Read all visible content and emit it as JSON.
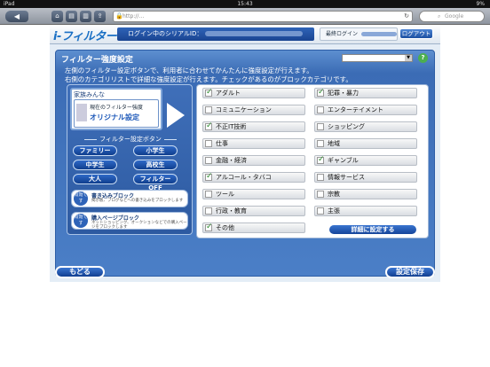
{
  "statusbar": {
    "device": "iPad",
    "time": "15:43",
    "battery": "9%"
  },
  "browser": {
    "back": "◀",
    "url_placeholder": "http://…",
    "search_placeholder": "Google"
  },
  "header": {
    "logo": "i-フィルター",
    "serial_label": "ログイン中のシリアルID：",
    "last_login_label": "最終ログイン",
    "logout": "ログアウト"
  },
  "panel": {
    "title": "フィルター強度設定",
    "desc_line1": "左側のフィルター設定ボタンで、利用者に合わせてかんたんに強度設定が行えます。",
    "desc_line2": "右側のカテゴリリストで詳細な強度設定が行えます。チェックがあるのがブロックカテゴリです。"
  },
  "profile": {
    "name": "家族みんな",
    "current_label": "現在のフィルター強度",
    "current_value": "オリジナル設定"
  },
  "presets": {
    "section_label": "フィルター設定ボタン",
    "buttons": [
      "ファミリー",
      "小学生",
      "中学生",
      "高校生",
      "大人",
      "フィルターOFF"
    ]
  },
  "blocks": [
    {
      "badge": "有効です",
      "title": "書き込みブロック",
      "sub": "掲示板、ブログなどへの書き込みをブロックします"
    },
    {
      "badge": "有効です",
      "title": "購入ページブロック",
      "sub": "ネットショッピング、オークションなどでの購入ページをブロックします"
    }
  ],
  "categories": [
    {
      "label": "アダルト",
      "checked": true
    },
    {
      "label": "犯罪・暴力",
      "checked": true
    },
    {
      "label": "コミュニケーション",
      "checked": false
    },
    {
      "label": "エンターテイメント",
      "checked": false
    },
    {
      "label": "不正IT技術",
      "checked": true
    },
    {
      "label": "ショッピング",
      "checked": false
    },
    {
      "label": "仕事",
      "checked": false
    },
    {
      "label": "地域",
      "checked": false
    },
    {
      "label": "金融・経済",
      "checked": false
    },
    {
      "label": "ギャンブル",
      "checked": true
    },
    {
      "label": "アルコール・タバコ",
      "checked": true
    },
    {
      "label": "情報サービス",
      "checked": false
    },
    {
      "label": "ツール",
      "checked": false
    },
    {
      "label": "宗教",
      "checked": false
    },
    {
      "label": "行政・教育",
      "checked": false
    },
    {
      "label": "主張",
      "checked": false
    },
    {
      "label": "その他",
      "checked": true
    }
  ],
  "buttons": {
    "detail": "詳細に設定する",
    "back": "もどる",
    "save": "設定保存"
  }
}
